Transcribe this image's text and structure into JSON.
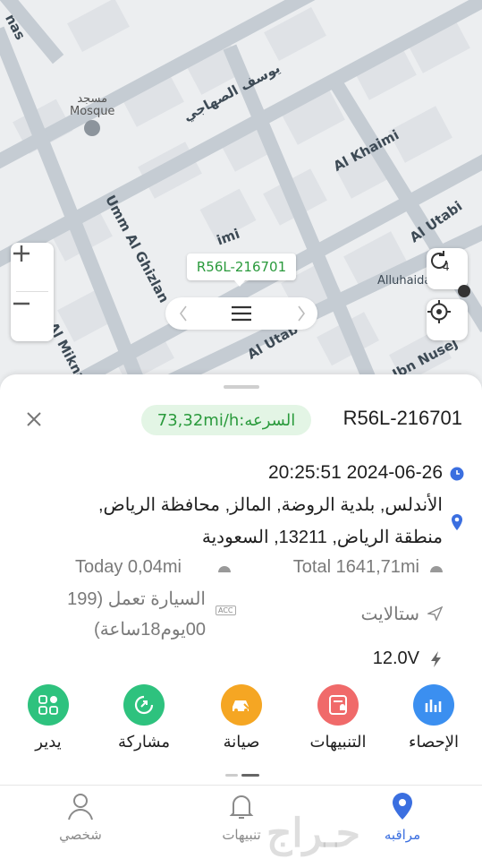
{
  "map": {
    "roads": {
      "yousef": "يوسف الصهاجي",
      "al_khaimi": "Al Khaimi",
      "umm_al_ghizlan": "Umm Al Ghizlan",
      "al_utabi": "Al Utabi",
      "al_utab": "Al Utab",
      "al_miknasi": "Al Miknasi",
      "ibn_nusej": "Ibn Nusej",
      "imi": "imi",
      "nas": "nas",
      "alluhaida": "Alluhaida"
    },
    "poi": {
      "line1": "مسجد",
      "line2": "Mosque"
    },
    "plate_tag": "R56L-216701",
    "zoom_in": "+",
    "zoom_out": "−",
    "refresh_count": "4"
  },
  "info": {
    "plate": "R56L-216701",
    "speed": "73,32mi/h:السرعه",
    "datetime": "20:25:51 2024-06-26",
    "address_line1": "الأندلس, بلدية الروضة, المالز, محافظة الرياض,",
    "address_line2": "منطقة الرياض, 13211, السعودية",
    "today": "Today 0,04mi",
    "total": "Total 1641,71mi",
    "running_line1": "السيارة تعمل  (199",
    "running_line2": "00يوم18ساعة)",
    "acc_label": "ACC",
    "satellite": "ستالايت",
    "voltage": "12.0V"
  },
  "features": [
    {
      "label": "يدير",
      "color": "#2ec27e"
    },
    {
      "label": "مشاركة",
      "color": "#2ec27e"
    },
    {
      "label": "صيانة",
      "color": "#f5a623"
    },
    {
      "label": "التنبيهات",
      "color": "#f06a6a"
    },
    {
      "label": "الإحصاء",
      "color": "#3b8ff0"
    }
  ],
  "tabs": [
    {
      "label": "شخصي"
    },
    {
      "label": "تنبيهات"
    },
    {
      "label": "مراقبه"
    }
  ],
  "colors": {
    "accent": "#2a9a3c",
    "active_tab": "#3b6fe0"
  }
}
